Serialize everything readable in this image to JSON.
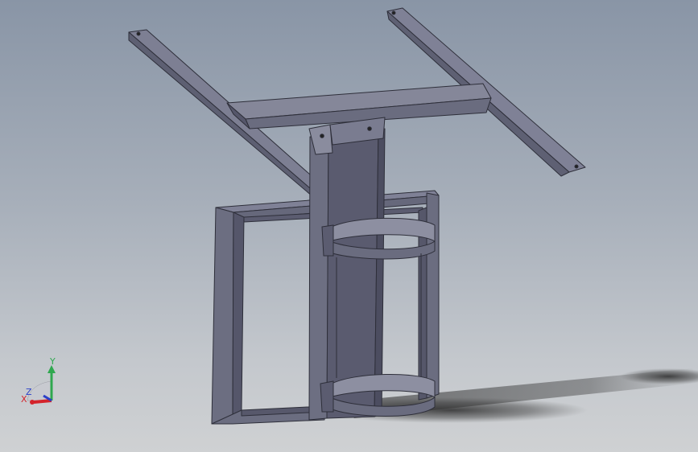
{
  "viewport": {
    "background_top": "#8995a6",
    "background_bottom": "#cfd1d3"
  },
  "model": {
    "colors": {
      "steel_light": "#7d7f93",
      "steel_mid": "#6b6d80",
      "steel_dark": "#55566a",
      "edge": "#2e2f3a",
      "shadow": "#333333"
    }
  },
  "triad": {
    "x_label": "X",
    "y_label": "Y",
    "z_label": "Z",
    "x_color": "#d4232b",
    "y_color": "#2fa84f",
    "z_color": "#2b3fc8"
  }
}
